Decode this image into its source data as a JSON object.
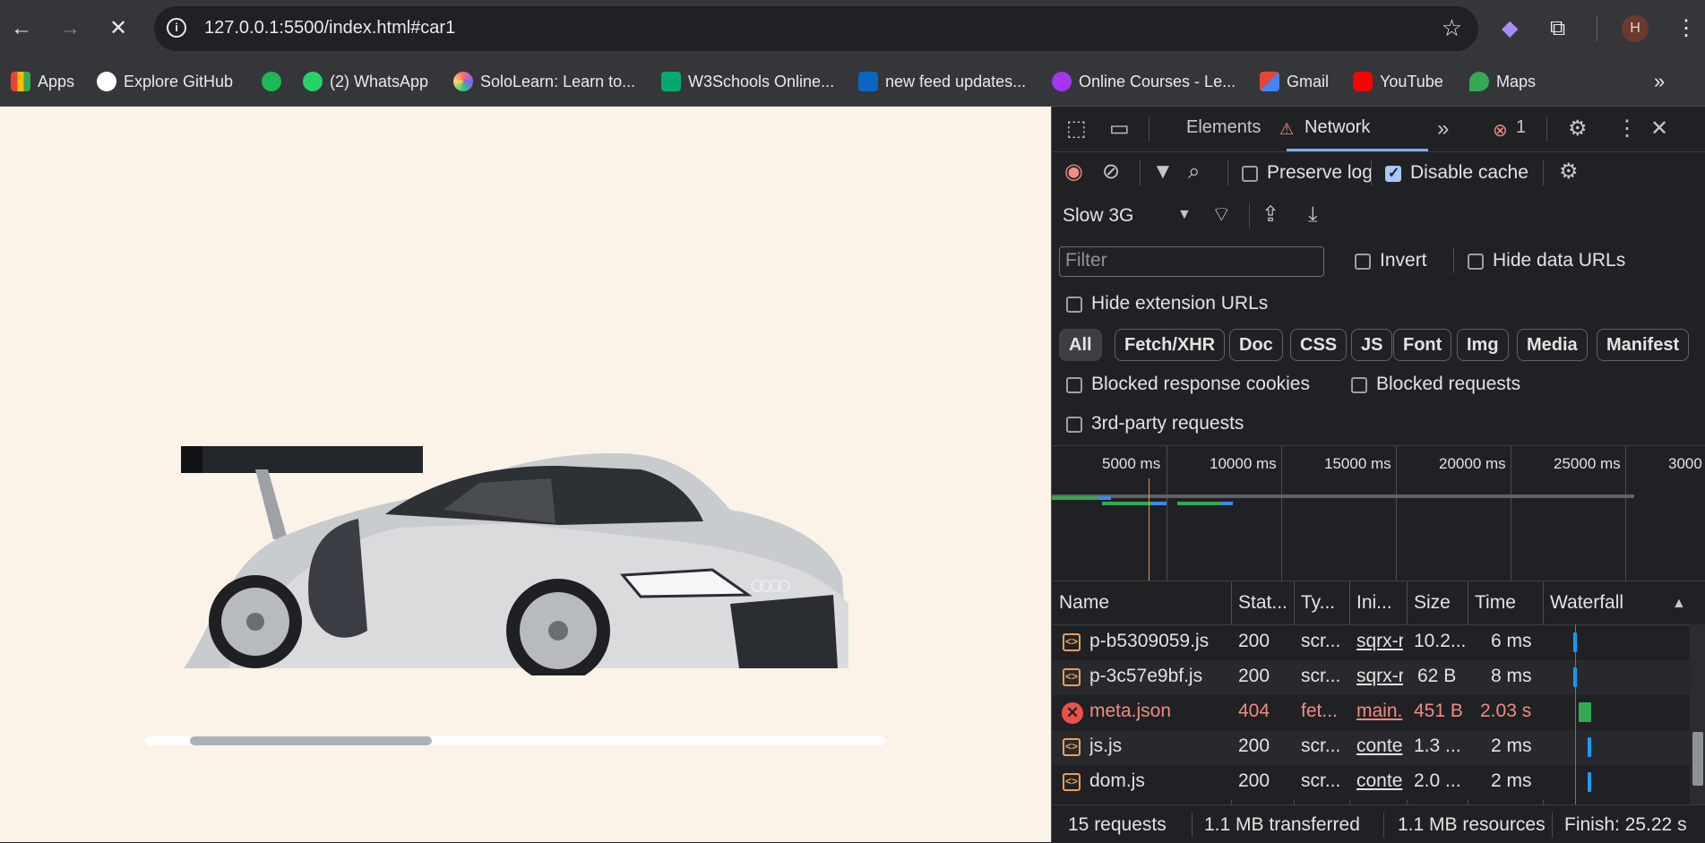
{
  "browser": {
    "url": "127.0.0.1:5500/index.html#car1",
    "avatar_letter": "H"
  },
  "bookmarks": [
    {
      "label": "Apps",
      "icon": "apps-grid-icon",
      "color": "#ea4335"
    },
    {
      "label": "Explore GitHub",
      "icon": "github-icon",
      "color": "#ffffff"
    },
    {
      "label": "",
      "icon": "spotify-icon",
      "color": "#1db954"
    },
    {
      "label": "(2) WhatsApp",
      "icon": "whatsapp-icon",
      "color": "#25d366"
    },
    {
      "label": "SoloLearn: Learn to...",
      "icon": "sololearn-icon",
      "color": "#7b61ff"
    },
    {
      "label": "W3Schools Online...",
      "icon": "w3schools-icon",
      "color": "#04aa6d"
    },
    {
      "label": "new feed updates...",
      "icon": "linkedin-icon",
      "color": "#0a66c2"
    },
    {
      "label": "Online Courses - Le...",
      "icon": "udemy-icon",
      "color": "#a435f0"
    },
    {
      "label": "Gmail",
      "icon": "gmail-icon",
      "color": "#ea4335"
    },
    {
      "label": "YouTube",
      "icon": "youtube-icon",
      "color": "#ff0000"
    },
    {
      "label": "Maps",
      "icon": "maps-icon",
      "color": "#34a853"
    }
  ],
  "page": {
    "background": "#fcf3e8",
    "car_image": "silver race car"
  },
  "devtools": {
    "tabs": [
      "Elements",
      "Network"
    ],
    "active_tab": "Network",
    "error_count": "1",
    "preserve_log": "Preserve log",
    "disable_cache": "Disable cache",
    "throttling": "Slow 3G",
    "filter_placeholder": "Filter",
    "invert": "Invert",
    "hide_data_urls": "Hide data URLs",
    "hide_extension_urls": "Hide extension URLs",
    "type_filters": [
      "All",
      "Fetch/XHR",
      "Doc",
      "CSS",
      "JS",
      "Font",
      "Img",
      "Media",
      "Manifest"
    ],
    "blocked_response_cookies": "Blocked response cookies",
    "blocked_requests": "Blocked requests",
    "third_party": "3rd-party requests",
    "timeline_ticks": [
      "5000 ms",
      "10000 ms",
      "15000 ms",
      "20000 ms",
      "25000 ms",
      "3000"
    ],
    "columns": [
      "Name",
      "Stat...",
      "Ty...",
      "Ini...",
      "Size",
      "Time",
      "Waterfall"
    ],
    "rows": [
      {
        "name": "p-b5309059.js",
        "status": "200",
        "type": "scr...",
        "initiator": "sqrx-r",
        "size": "10.2...",
        "time": "6 ms",
        "error": false
      },
      {
        "name": "p-3c57e9bf.js",
        "status": "200",
        "type": "scr...",
        "initiator": "sqrx-r",
        "size": "62 B",
        "time": "8 ms",
        "error": false
      },
      {
        "name": "meta.json",
        "status": "404",
        "type": "fet...",
        "initiator": "main.",
        "size": "451 B",
        "time": "2.03 s",
        "error": true
      },
      {
        "name": "js.js",
        "status": "200",
        "type": "scr...",
        "initiator": "conte",
        "size": "1.3 ...",
        "time": "2 ms",
        "error": false
      },
      {
        "name": "dom.js",
        "status": "200",
        "type": "scr...",
        "initiator": "conte",
        "size": "2.0 ...",
        "time": "2 ms",
        "error": false
      }
    ],
    "status": {
      "requests": "15 requests",
      "transferred": "1.1 MB transferred",
      "resources": "1.1 MB resources",
      "finish": "Finish: 25.22 s"
    }
  }
}
